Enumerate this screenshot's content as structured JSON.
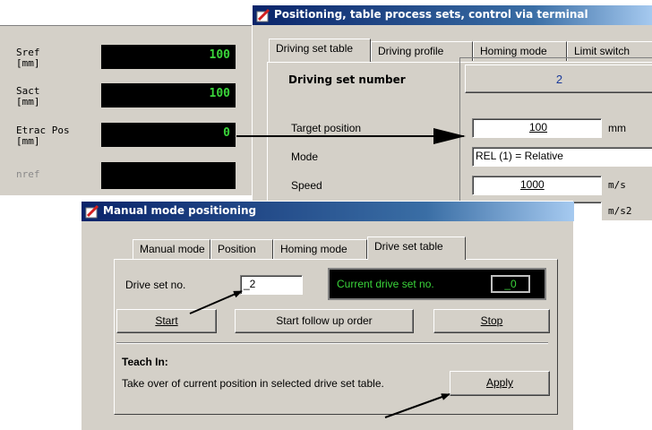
{
  "monitor": {
    "rows": [
      {
        "label": "Sref",
        "unit": "[mm]",
        "value": "100"
      },
      {
        "label": "Sact",
        "unit": "[mm]",
        "value": "100"
      },
      {
        "label": "Etrac Pos",
        "unit": "[mm]",
        "value": "0"
      },
      {
        "label": "nref",
        "unit": "",
        "value": ""
      }
    ]
  },
  "positioning_window": {
    "title": "Positioning, table process sets, control via terminal",
    "tabs": [
      "Driving set table",
      "Driving profile",
      "Homing mode",
      "Limit switch"
    ],
    "active_tab": "Driving set table",
    "set_number_label": "Driving set number",
    "set_number_value": "2",
    "fields": [
      {
        "label": "Target position",
        "value": "100",
        "unit": "mm"
      },
      {
        "label": "Mode",
        "value": "REL (1) = Relative",
        "unit": ""
      },
      {
        "label": "Speed",
        "value": "1000",
        "unit": "m/s"
      },
      {
        "label": "",
        "value": "",
        "unit": "m/s2"
      }
    ]
  },
  "manual_window": {
    "title": "Manual mode positioning",
    "tabs": [
      "Manual mode",
      "Position",
      "Homing mode",
      "Drive set table"
    ],
    "active_tab": "Drive set table",
    "drive_set_label": "Drive set no.",
    "drive_set_value": "_2",
    "current_set_label": "Current drive set no.",
    "current_set_value": "_0",
    "start_button": "Start",
    "follow_button": "Start follow up order",
    "stop_button": "Stop",
    "teach_heading": "Teach In:",
    "teach_text": "Take over of current position in selected drive set table.",
    "apply_button": "Apply"
  },
  "colors": {
    "lcd_text": "#3ad43a",
    "title_start": "#0a246a",
    "window_bg": "#d4d0c8"
  }
}
